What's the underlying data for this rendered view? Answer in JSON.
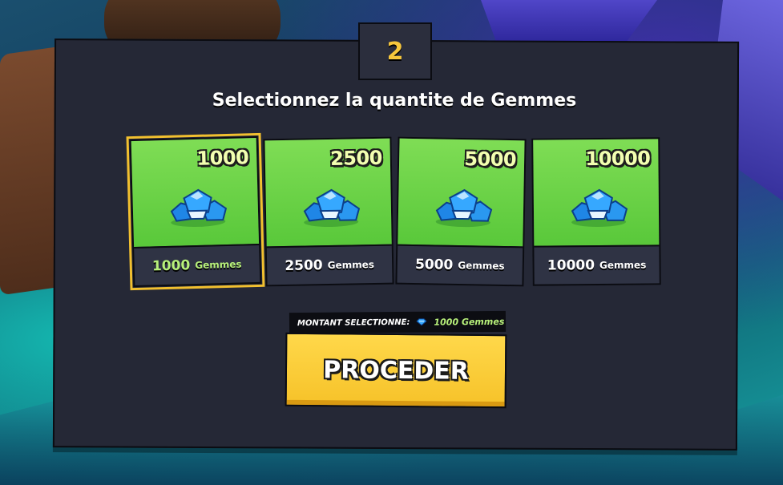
{
  "step": {
    "number": "2"
  },
  "title": "Selectionnez la quantite de Gemmes",
  "packages": [
    {
      "amount": "1000",
      "label_amount": "1000",
      "label_unit": "Gemmes",
      "selected": true,
      "icon": "gem-pile-icon"
    },
    {
      "amount": "2500",
      "label_amount": "2500",
      "label_unit": "Gemmes",
      "selected": false,
      "icon": "gem-pile-icon"
    },
    {
      "amount": "5000",
      "label_amount": "5000",
      "label_unit": "Gemmes",
      "selected": false,
      "icon": "gem-pile-icon"
    },
    {
      "amount": "10000",
      "label_amount": "10000",
      "label_unit": "Gemmes",
      "selected": false,
      "icon": "gem-pile-icon"
    }
  ],
  "selection": {
    "label": "MONTANT SELECTIONNE:",
    "value": "1000 Gemmes",
    "icon": "gem-icon"
  },
  "proceed_button": {
    "label": "PROCEDER"
  },
  "colors": {
    "panel": "#252836",
    "card_top": "#6fd44a",
    "selected_outline": "#f2c02f",
    "accent_green_text": "#b7f07a",
    "button": "#f6c229",
    "step_number": "#f6c63c"
  }
}
